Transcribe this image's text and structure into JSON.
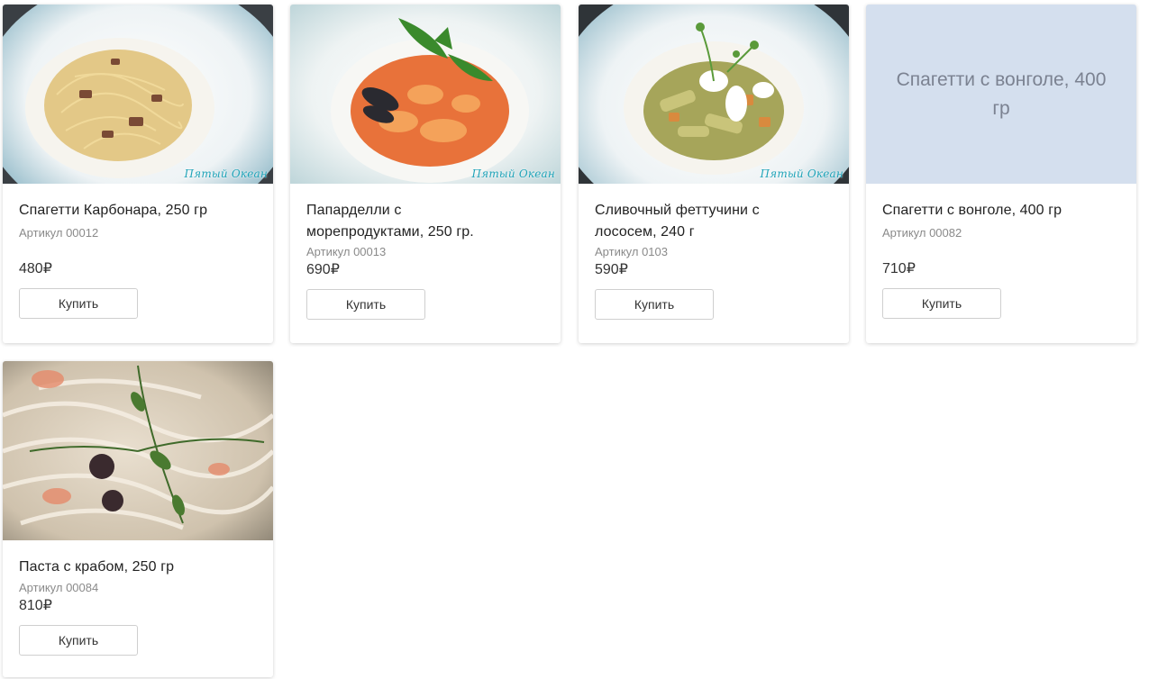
{
  "currency_symbol": "₽",
  "buy_label": "Купить",
  "brand_label": "Пятый Океан",
  "products": [
    {
      "title": "Спагетти Карбонара, 250 гр",
      "sku": "Артикул 00012",
      "price": "480₽",
      "image": "spaghetti-carbonara-photo"
    },
    {
      "title": "Папарделли с морепродуктами, 250 гр.",
      "sku": "Артикул 00013",
      "price": "690₽",
      "image": "pappardelle-seafood-photo"
    },
    {
      "title": "Сливочный феттучини с лососем, 240 г",
      "sku": "Артикул 0103",
      "price": "590₽",
      "image": "fettuccine-salmon-photo"
    },
    {
      "title": "Спагетти с вонголе, 400 гр",
      "sku": "Артикул 00082",
      "price": "710₽",
      "image_placeholder_text": "Спагетти с вонголе, 400 гр"
    },
    {
      "title": "Паста с крабом, 250 гр",
      "sku": "Артикул 00084",
      "price": "810₽",
      "image": "crab-pasta-photo"
    }
  ],
  "colors": {
    "placeholder_bg": "#d4dfee",
    "brand_teal": "#1fa3b8",
    "button_border": "#cfcfcf"
  }
}
